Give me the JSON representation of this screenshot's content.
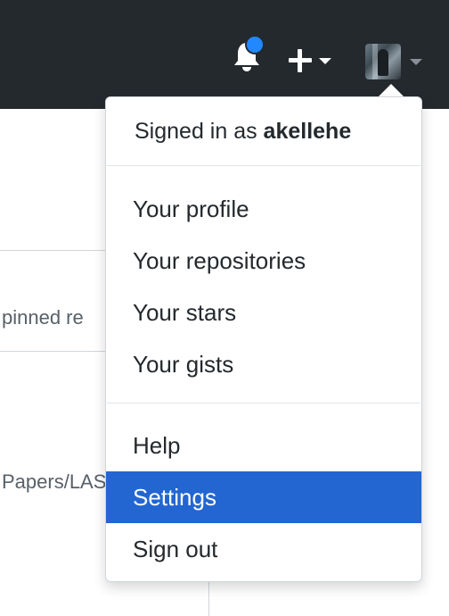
{
  "header": {
    "notification_icon": "bell-icon",
    "create_icon": "plus-icon",
    "menu_caret_icon": "caret-down-icon"
  },
  "background": {
    "pinned_text": "pinned re",
    "path_text": "Papers/LAS"
  },
  "dropdown": {
    "signed_in_prefix": "Signed in as ",
    "username": "akellehe",
    "items": [
      {
        "label": "Your profile"
      },
      {
        "label": "Your repositories"
      },
      {
        "label": "Your stars"
      },
      {
        "label": "Your gists"
      },
      {
        "label": "Help"
      },
      {
        "label": "Settings",
        "active": true
      },
      {
        "label": "Sign out"
      }
    ]
  },
  "colors": {
    "header_bg": "#24292e",
    "active_item_bg": "#2366d1",
    "notification_dot": "#2188ff"
  }
}
